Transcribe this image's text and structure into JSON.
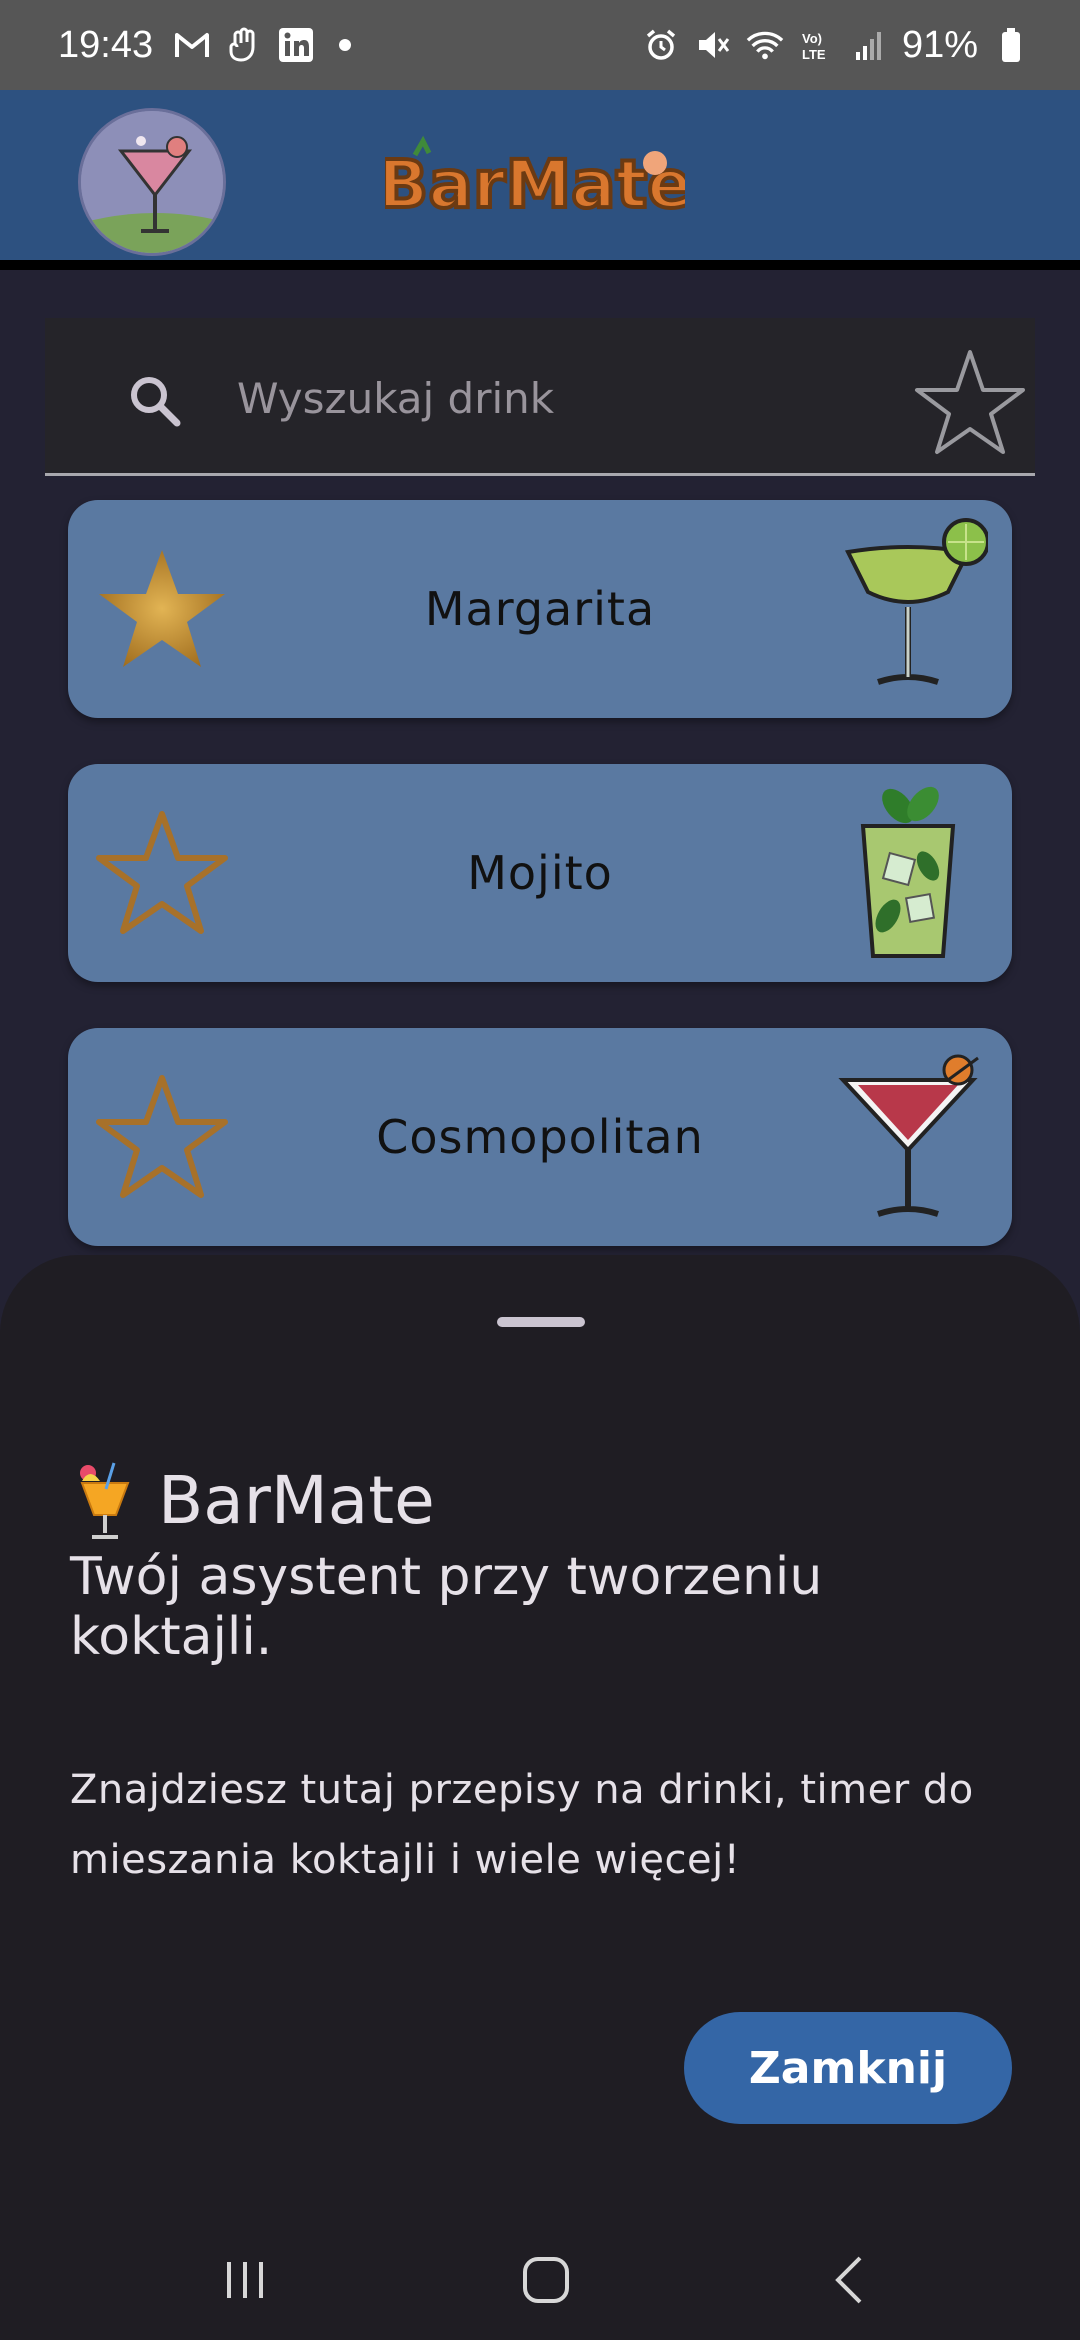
{
  "status_bar": {
    "time": "19:43",
    "battery": "91%",
    "icons": [
      "gmail-icon",
      "hand-icon",
      "linkedin-icon",
      "notification-dot",
      "alarm-icon",
      "mute-icon",
      "wifi-icon",
      "volte-icon",
      "signal-icon",
      "battery-icon"
    ]
  },
  "header": {
    "logo_text": "BarMate",
    "accent": "#2d5180"
  },
  "search": {
    "placeholder": "Wyszukaj drink",
    "value": ""
  },
  "drinks": [
    {
      "name": "Margarita",
      "favorite": true,
      "icon": "margarita-glass-icon"
    },
    {
      "name": "Mojito",
      "favorite": false,
      "icon": "mojito-glass-icon"
    },
    {
      "name": "Cosmopolitan",
      "favorite": false,
      "icon": "cosmopolitan-glass-icon"
    }
  ],
  "sheet": {
    "title": "BarMate",
    "title_icon": "tropical-drink-emoji",
    "subtitle": "Twój asystent przy tworzeniu koktajli.",
    "body": "Znajdziesz tutaj przepisy na drinki, timer do mieszania koktajli i wiele więcej!",
    "close_label": "Zamknij"
  },
  "colors": {
    "card": "#5a79a1",
    "sheet": "#1f1d23",
    "button": "#3466a6",
    "star_gold": "#c99a3a"
  }
}
